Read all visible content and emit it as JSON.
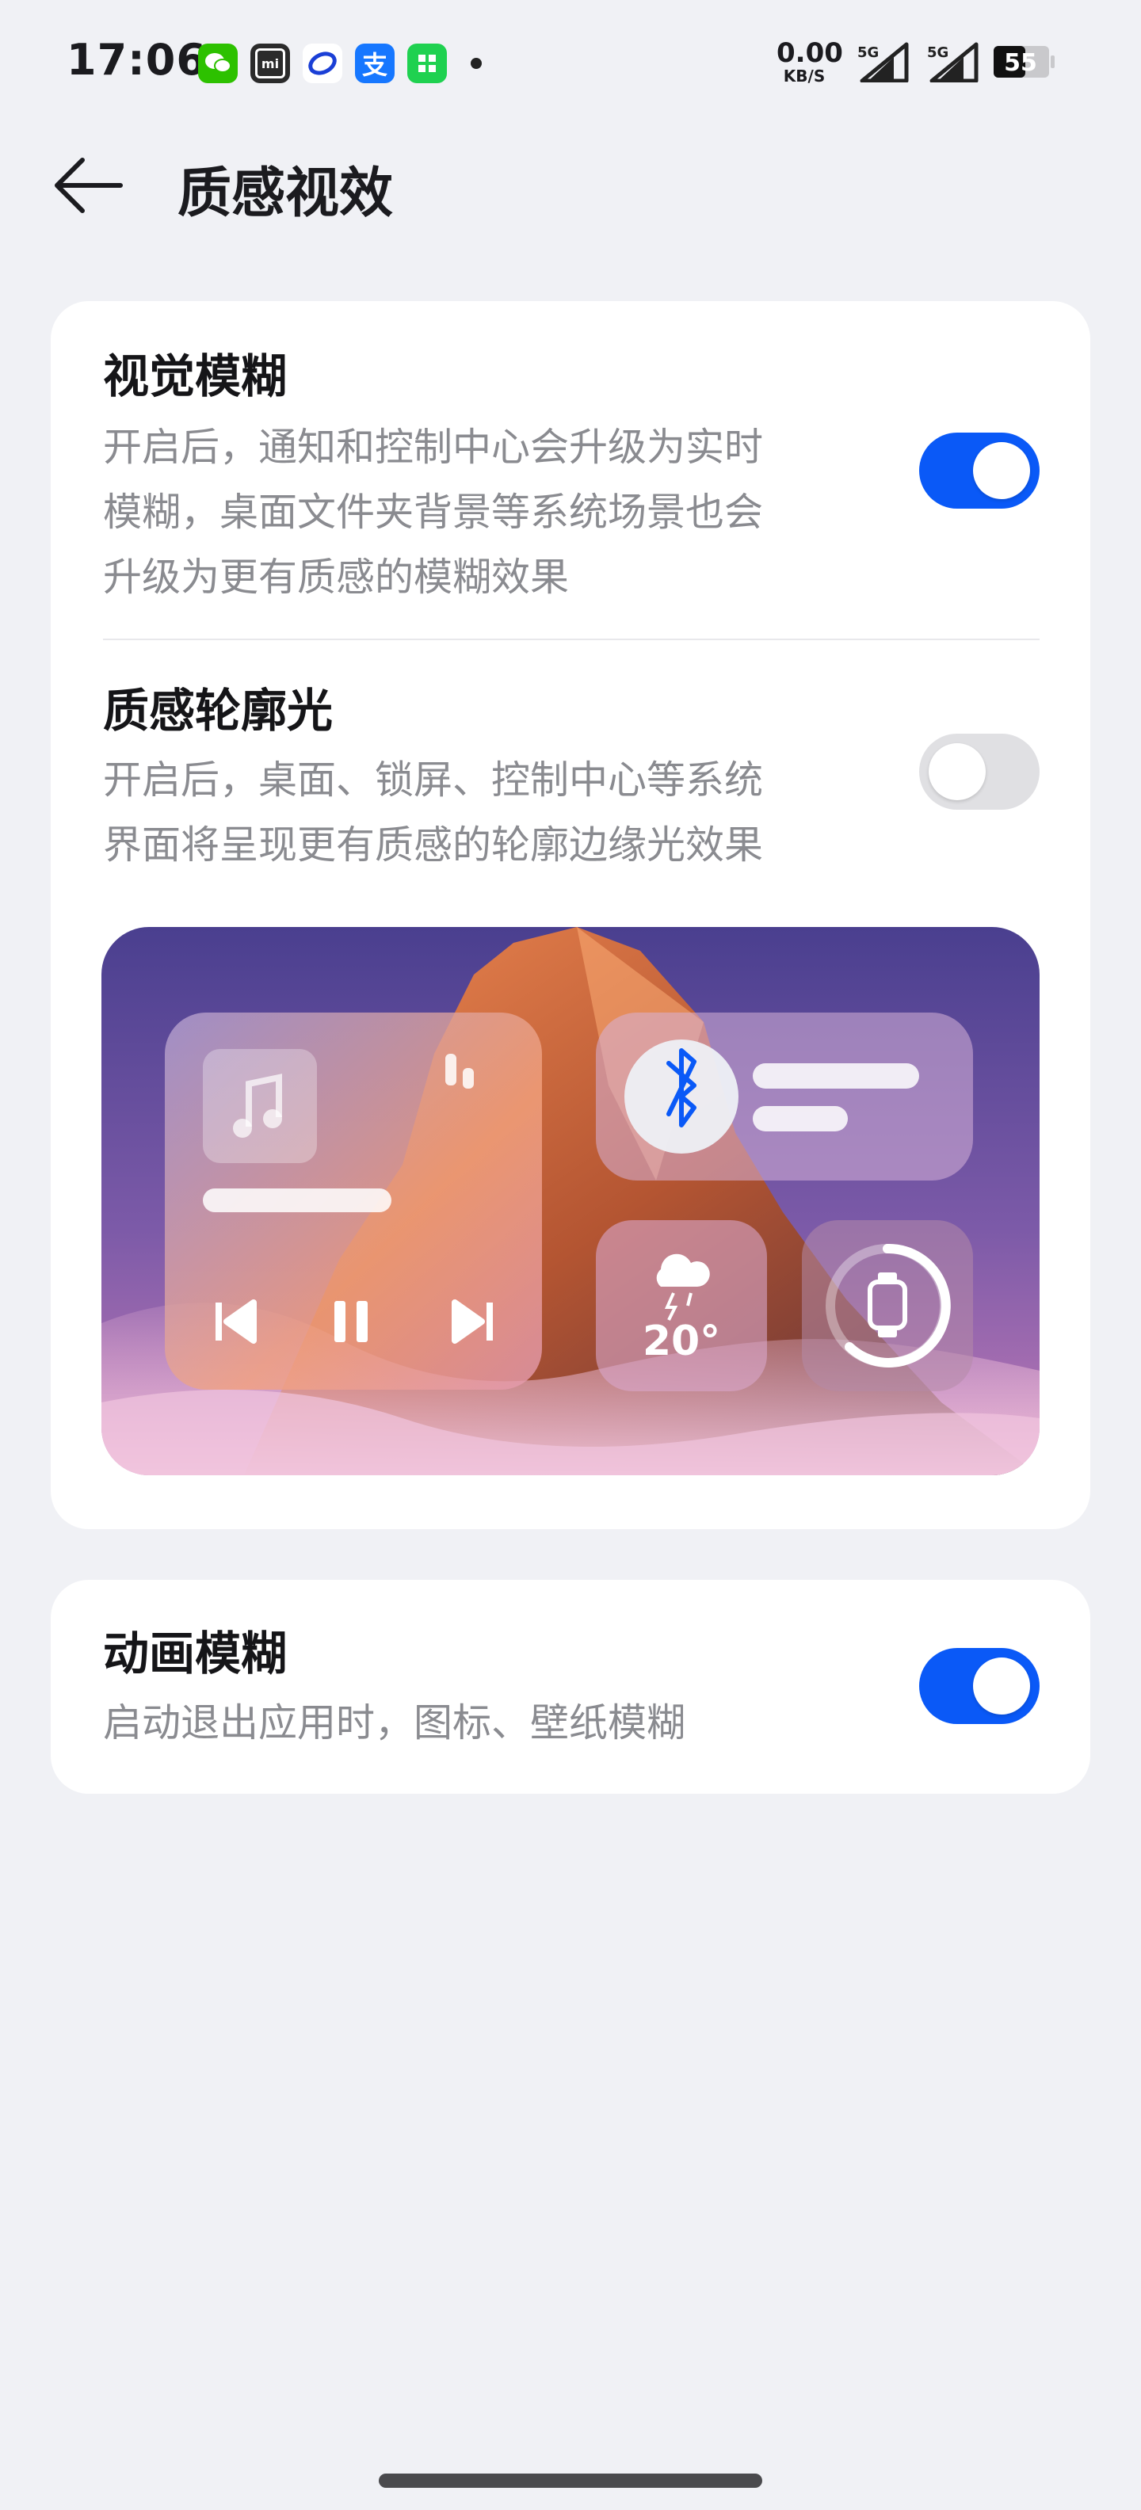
{
  "status_bar": {
    "time": "17:06",
    "app_icons": [
      {
        "name": "wechat-icon",
        "color": "#2dc100",
        "glyph": "◉"
      },
      {
        "name": "mi-icon",
        "color": "#2b2b2b",
        "glyph": "mi"
      },
      {
        "name": "browser-icon",
        "color": "#ffffff",
        "glyph": "◎"
      },
      {
        "name": "alipay-icon",
        "color": "#1677ff",
        "glyph": "支"
      },
      {
        "name": "app-green-icon",
        "color": "#1fd150",
        "glyph": "▦"
      }
    ],
    "net_speed_value": "0.00",
    "net_speed_unit": "KB/S",
    "signal_label": "5G",
    "battery_level": "55"
  },
  "header": {
    "title": "质感视效"
  },
  "settings": {
    "visual_blur": {
      "title": "视觉模糊",
      "desc_lines": [
        "开启后，通知和控制中心会升级为实时",
        "模糊，桌面文件夹背景等系统场景也会",
        "升级为更有质感的模糊效果"
      ],
      "enabled": true
    },
    "outline_light": {
      "title": "质感轮廓光",
      "desc_lines": [
        "开启后，桌面、锁屏、控制中心等系统",
        "界面将呈现更有质感的轮廓边缘光效果"
      ],
      "enabled": false
    },
    "animation_blur": {
      "title": "动画模糊",
      "desc": "启动退出应用时，图标、壁纸模糊",
      "enabled": true
    }
  },
  "preview": {
    "weather_temp": "20°"
  },
  "colors": {
    "accent": "#0a59f7",
    "background": "#f0f1f5",
    "toggle_off": "#e0e0e3"
  }
}
